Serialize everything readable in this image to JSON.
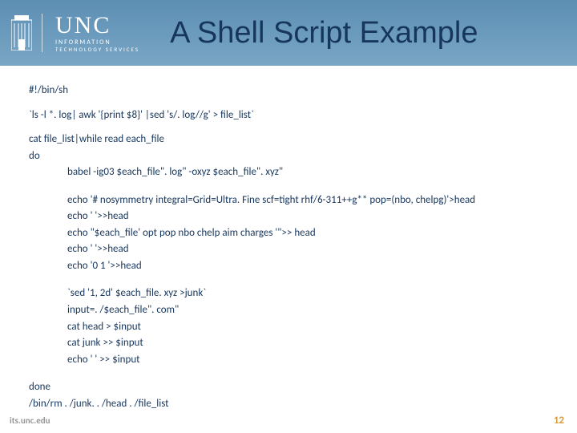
{
  "header": {
    "logo_top": "UNC",
    "logo_sub1": "INFORMATION",
    "logo_sub2": "TECHNOLOGY SERVICES",
    "title": "A Shell Script Example"
  },
  "code": {
    "l1": "#!/bin/sh",
    "l2": "`ls -l *. log| awk '{print $8}' |sed 's/. log//g' > file_list`",
    "l3": "cat file_list|while read each_file",
    "l4": "do",
    "l5": "babel -ig03 $each_file\". log\" -oxyz $each_file\". xyz\"",
    "l6": "echo '# nosymmetry integral=Grid=Ultra. Fine scf=tight rhf/6-311++g** pop=(nbo, chelpg)'>head",
    "l7": "echo ' '>>head",
    "l8": "echo \"$each_file' opt pop nbo chelp aim charges '\">> head",
    "l9": "echo ' '>>head",
    "l10": "echo '0 1 '>>head",
    "l11": "`sed '1, 2d' $each_file. xyz >junk`",
    "l12": "input=. /$each_file\". com\"",
    "l13": "cat head  > $input",
    "l14": "cat junk >> $input",
    "l15": "echo ' '  >> $input",
    "l16": "done",
    "l17": "/bin/rm . /junk. . /head . /file_list"
  },
  "footer": {
    "url": "its.unc.edu",
    "page": "12"
  }
}
